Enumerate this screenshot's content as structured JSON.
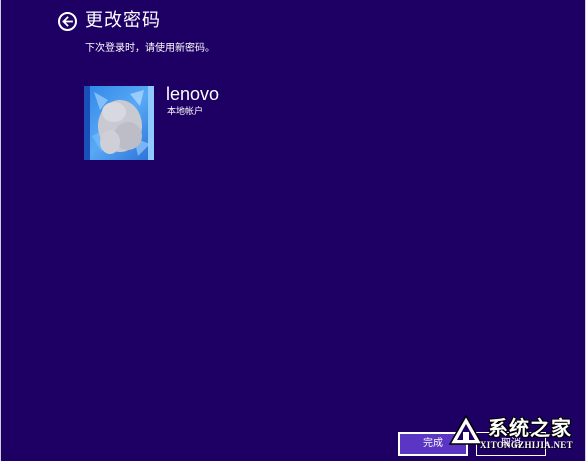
{
  "page": {
    "title": "更改密码",
    "subtitle": "下次登录时，请使用新密码。"
  },
  "account": {
    "username": "lenovo",
    "type": "本地帐户"
  },
  "buttons": {
    "finish": "完成",
    "cancel": "取消"
  },
  "icons": {
    "back": "back-arrow-icon"
  },
  "watermark": {
    "name": "系统之家",
    "url": "XITONGZHIJIA.NET"
  },
  "colors": {
    "background": "#1e0064",
    "text": "#ffffff",
    "accent_button": "#5b36c4"
  }
}
